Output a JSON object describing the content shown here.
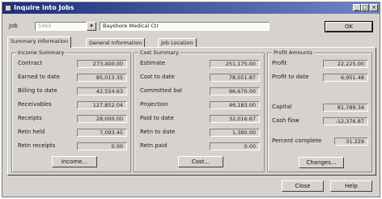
{
  "window": {
    "title": "Inquire into Jobs"
  },
  "header": {
    "job_label": "Job",
    "job_value": "5465",
    "job_description": "Bayshore Medical Ctr",
    "ok_label": "OK"
  },
  "tabs": [
    {
      "label": "Summary Information"
    },
    {
      "label": "General Information"
    },
    {
      "label": "Job Location"
    }
  ],
  "income_summary": {
    "title": "Income Summary",
    "rows": [
      {
        "label": "Contract",
        "value": "273,400.00"
      },
      {
        "label": "Earned to date",
        "value": "85,013.35"
      },
      {
        "label": "Billing to date",
        "value": "42,554.63"
      },
      {
        "label": "Receivables",
        "value": "127,852.04"
      },
      {
        "label": "Receipts",
        "value": "28,000.00"
      },
      {
        "label": "Retn held",
        "value": "7,093.45"
      },
      {
        "label": "Retn receipts",
        "value": "0.00"
      }
    ],
    "button_label": "Income..."
  },
  "cost_summary": {
    "title": "Cost Summary",
    "rows": [
      {
        "label": "Estimate",
        "value": "251,175.00"
      },
      {
        "label": "Cost to date",
        "value": "78,051.87"
      },
      {
        "label": "Committed bal",
        "value": "96,670.00"
      },
      {
        "label": "Projection",
        "value": "46,183.00"
      },
      {
        "label": "Paid to date",
        "value": "32,016.67"
      },
      {
        "label": "Retn to date",
        "value": "1,380.00"
      },
      {
        "label": "Retn paid",
        "value": "0.00"
      }
    ],
    "button_label": "Cost..."
  },
  "profit_amounts": {
    "title": "Profit Amounts",
    "rows": [
      {
        "label": "Profit",
        "value": "22,225.00"
      },
      {
        "label": "Profit to date",
        "value": "6,951.48"
      },
      {
        "label": "Capital",
        "value": "81,789.34"
      },
      {
        "label": "Cash flow",
        "value": "-12,376.87"
      },
      {
        "label": "Percent complete",
        "value": "31.229"
      }
    ],
    "button_label": "Changes..."
  },
  "footer": {
    "close_label": "Close",
    "help_label": "Help"
  }
}
